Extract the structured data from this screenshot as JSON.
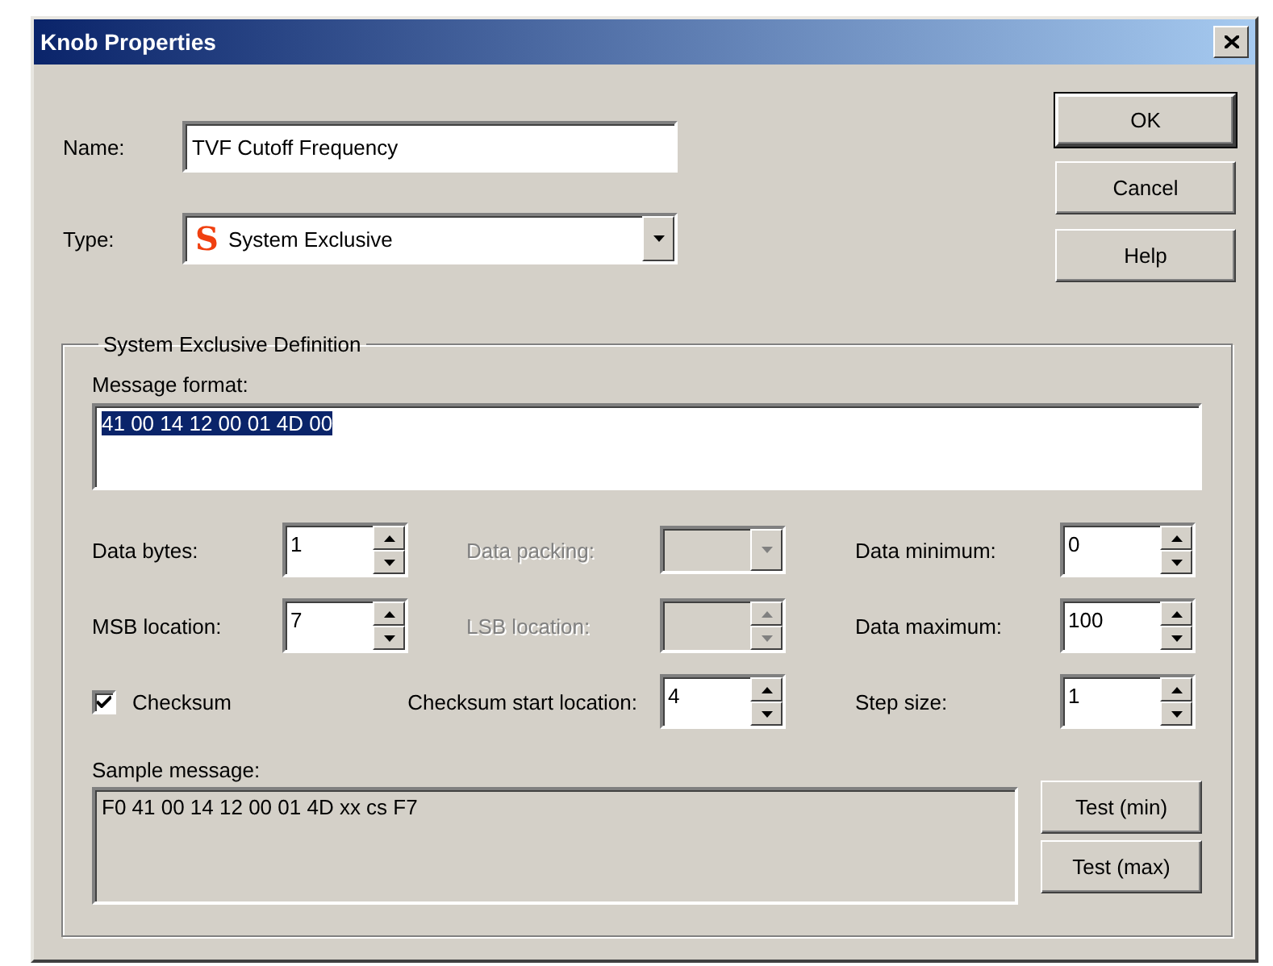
{
  "window": {
    "title": "Knob Properties"
  },
  "name_field": {
    "label": "Name:",
    "value": "TVF Cutoff Frequency"
  },
  "type_field": {
    "label": "Type:",
    "badge": "S",
    "value": "System Exclusive"
  },
  "buttons": [
    {
      "label": "OK",
      "default": true
    },
    {
      "label": "Cancel",
      "default": false
    },
    {
      "label": "Help",
      "default": false
    }
  ],
  "group": {
    "title": "System Exclusive Definition",
    "message_format": {
      "label": "Message format:",
      "value": "41 00 14 12 00 01 4D 00",
      "selected": true
    },
    "controls": [
      {
        "kind": "spin",
        "label": "Data bytes:",
        "value": "1",
        "disabled": false
      },
      {
        "kind": "dropdown",
        "label": "Data packing:",
        "disabled": true
      },
      {
        "kind": "spin",
        "label": "Data minimum:",
        "value": "0",
        "disabled": false
      },
      {
        "kind": "spin",
        "label": "MSB location:",
        "value": "7",
        "disabled": false
      },
      {
        "kind": "spin",
        "label": "LSB location:",
        "disabled": true
      },
      {
        "kind": "spin",
        "label": "Data maximum:",
        "value": "100",
        "disabled": false
      },
      {
        "kind": "checkbox",
        "label": "Checksum",
        "checked": true
      },
      {
        "kind": "spin",
        "label": "Checksum start location:",
        "value": "4",
        "disabled": false
      },
      {
        "kind": "spin",
        "label": "Step size:",
        "value": "1",
        "disabled": false
      }
    ],
    "sample": {
      "label": "Sample message:",
      "value": "F0 41 00 14 12 00 01 4D xx cs F7"
    },
    "test_buttons": [
      "Test (min)",
      "Test (max)"
    ]
  }
}
